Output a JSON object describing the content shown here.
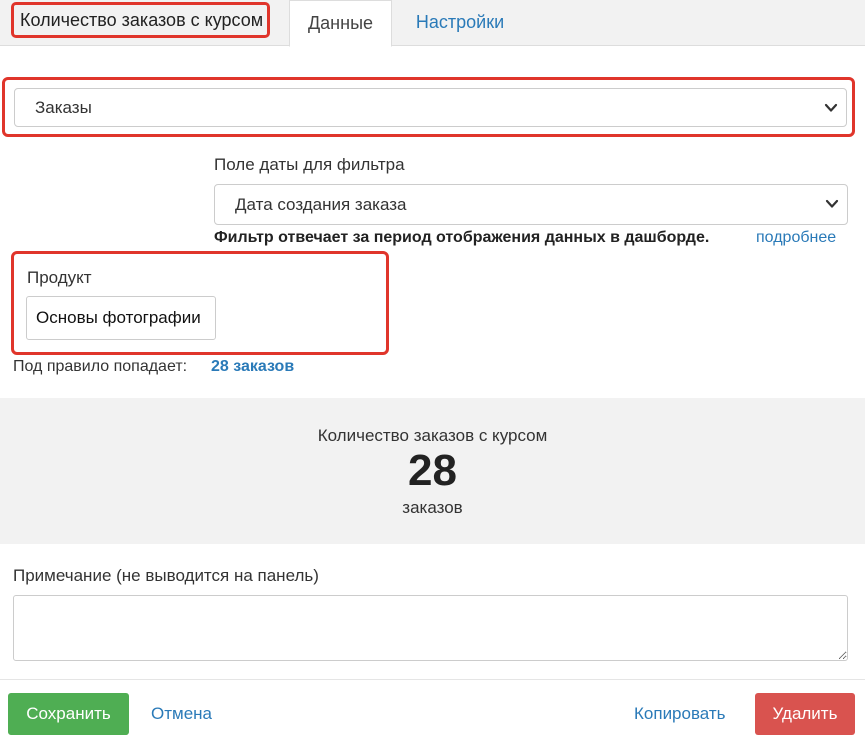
{
  "widget": {
    "title": "Количество заказов с курсом"
  },
  "tabs": [
    {
      "label": "Данные",
      "active": true
    },
    {
      "label": "Настройки",
      "active": false
    }
  ],
  "source": {
    "selected": "Заказы"
  },
  "date_filter": {
    "label": "Поле даты для фильтра",
    "selected": "Дата создания заказа",
    "hint": "Фильтр отвечает за период отображения данных в дашборде.",
    "hint_link": "подробнее"
  },
  "product_filter": {
    "label": "Продукт",
    "value": "Основы фотографии"
  },
  "rule": {
    "text": "Под правило попадает:",
    "count": "28 заказов"
  },
  "preview": {
    "title": "Количество заказов с курсом",
    "value": "28",
    "unit": "заказов"
  },
  "note": {
    "label": "Примечание (не выводится на панель)",
    "value": ""
  },
  "actions": {
    "save": "Сохранить",
    "cancel": "Отмена",
    "copy": "Копировать",
    "delete": "Удалить"
  },
  "colors": {
    "highlight": "#e0352b",
    "link": "#2a7ab8",
    "save": "#4fae53",
    "delete": "#d9534f"
  },
  "icons": {
    "select_chevron": "chevron-down-icon"
  }
}
